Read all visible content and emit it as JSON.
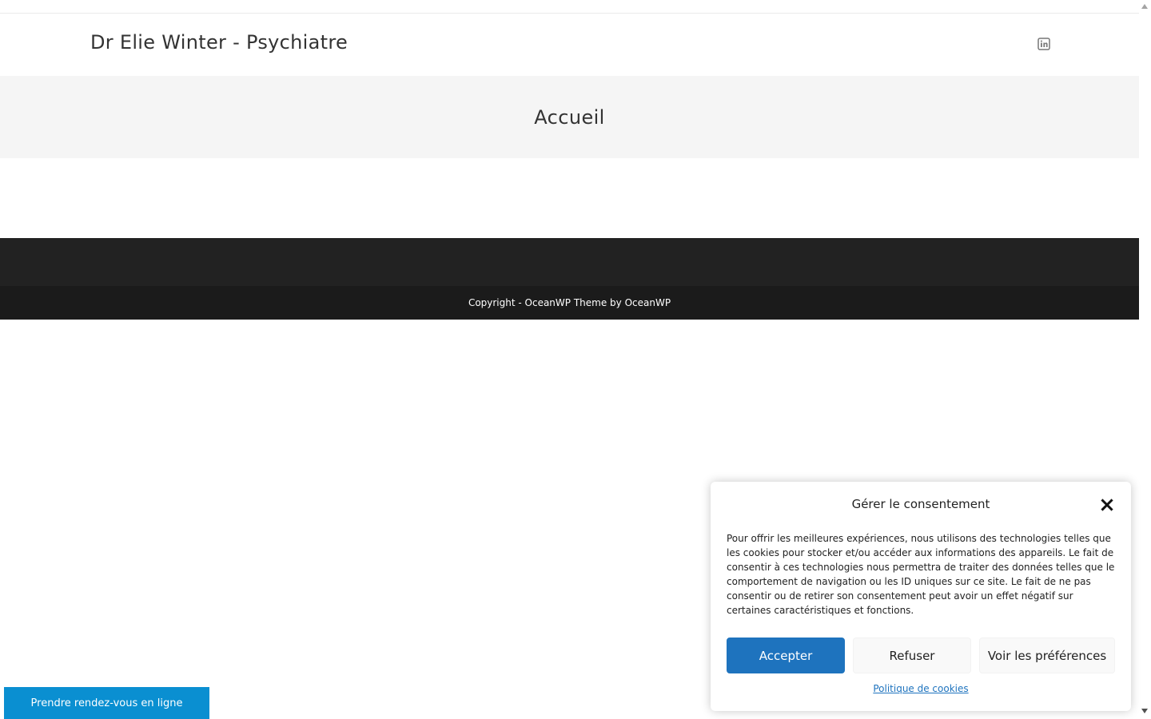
{
  "site": {
    "title": "Dr Elie Winter - Psychiatre",
    "social_icon": "linkedin-icon"
  },
  "page": {
    "heading": "Accueil"
  },
  "footer": {
    "copyright": "Copyright - OceanWP Theme by OceanWP"
  },
  "rdv_button": {
    "label": "Prendre rendez-vous en ligne"
  },
  "cookie_banner": {
    "title": "Gérer le consentement",
    "close_icon": "close-icon",
    "message": "Pour offrir les meilleures expériences, nous utilisons des technologies telles que les cookies pour stocker et/ou accéder aux informations des appareils. Le fait de consentir à ces technologies nous permettra de traiter des données telles que le comportement de navigation ou les ID uniques sur ce site. Le fait de ne pas consentir ou de retirer son consentement peut avoir un effet négatif sur certaines caractéristiques et fonctions.",
    "accept_label": "Accepter",
    "deny_label": "Refuser",
    "preferences_label": "Voir les préférences",
    "policy_link": "Politique de cookies"
  },
  "colors": {
    "accent": "#1e73be",
    "rdv_button": "#0a8fd1",
    "footer": "#222222",
    "footer_bottom": "#1b1b1b",
    "page_header_bg": "#f5f5f5"
  }
}
